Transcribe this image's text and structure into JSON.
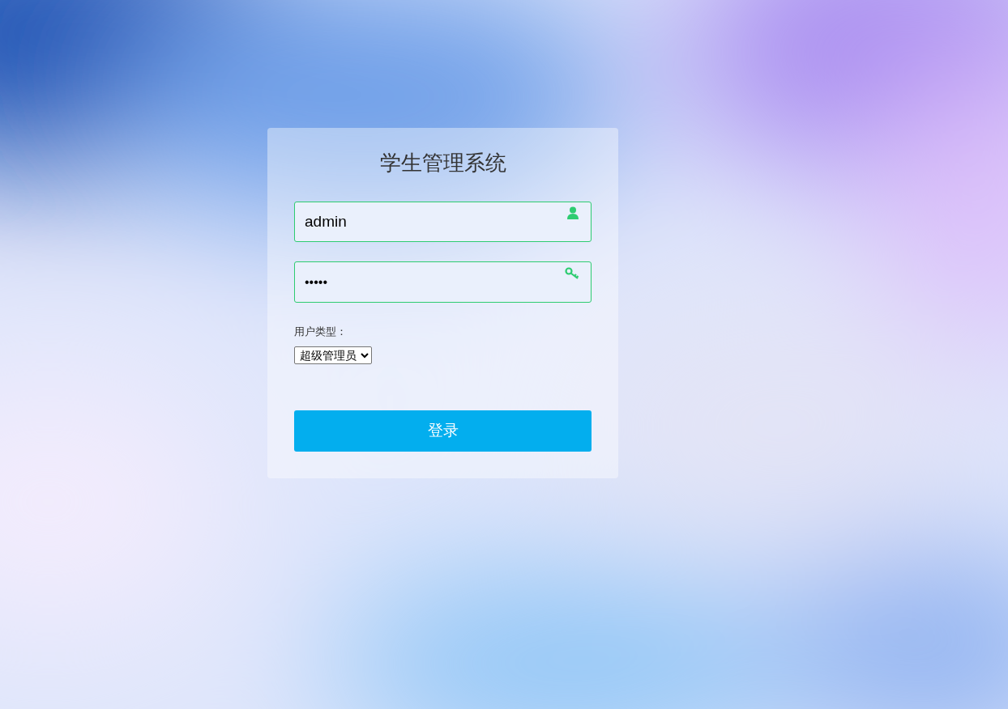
{
  "login": {
    "title": "学生管理系统",
    "username": {
      "value": "admin"
    },
    "password": {
      "value": "•••••"
    },
    "user_type": {
      "label": "用户类型：",
      "value": "超级管理员"
    },
    "submit": "登录"
  }
}
